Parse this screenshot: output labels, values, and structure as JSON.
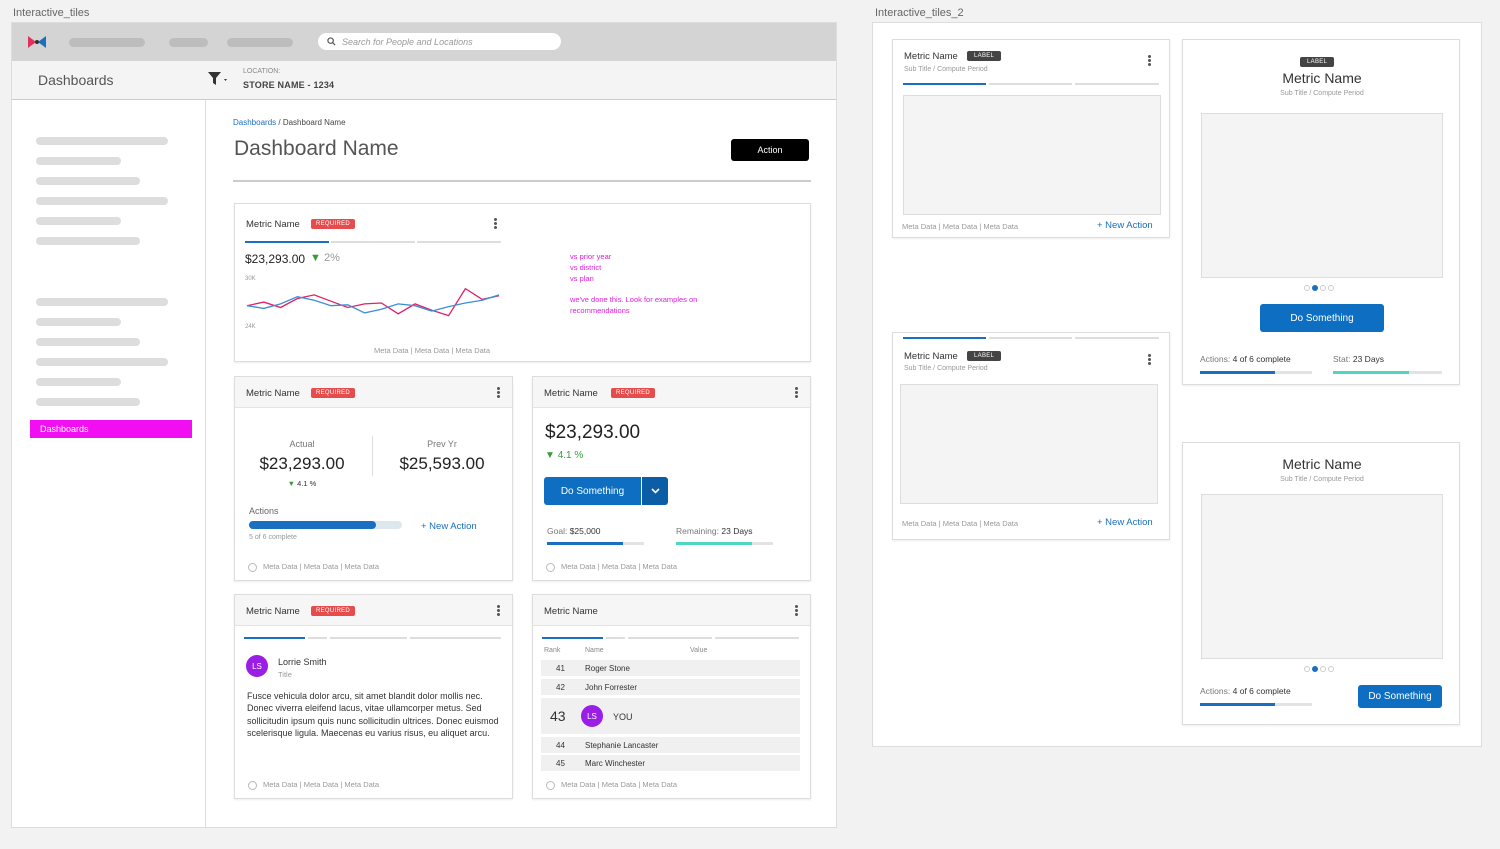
{
  "frame1_label": "Interactive_tiles",
  "frame2_label": "Interactive_tiles_2",
  "search": {
    "placeholder": "Search for People and Locations"
  },
  "header": {
    "title": "Dashboards",
    "location_label": "LOCATION:",
    "location_value": "STORE NAME - 1234"
  },
  "sidebar": {
    "active_label": "Dashboards"
  },
  "breadcrumb": {
    "root": "Dashboards",
    "separator": " / ",
    "current": "Dashboard Name"
  },
  "page": {
    "title": "Dashboard Name",
    "action_label": "Action"
  },
  "colors": {
    "accent": "#1a6fc1",
    "required": "#e74c4c",
    "magenta": "#f20ef2",
    "teal": "#4fd6c3"
  },
  "card_trend": {
    "metric": "Metric Name",
    "badge": "REQUIRED",
    "value": "$23,293.00",
    "change": "2%",
    "tick_hi": "30K",
    "tick_lo": "24K",
    "notes1": [
      "vs prior year",
      "vs  district",
      "vs plan"
    ],
    "notes2": [
      "we've done this. Look for examples on",
      "recommendations"
    ],
    "meta": "Meta Data | Meta Data | Meta Data"
  },
  "chart_data": {
    "type": "line",
    "ylim": [
      24000,
      30000
    ],
    "series": [
      {
        "values": [
          26700,
          27100,
          26500,
          27500,
          27900,
          27200,
          26500,
          26900,
          27000,
          25800,
          26900,
          26200,
          25600,
          28600,
          27400,
          27800
        ]
      },
      {
        "values": [
          26700,
          26400,
          26900,
          27700,
          27300,
          26700,
          26800,
          25900,
          26300,
          26900,
          26700,
          26100,
          26600,
          27000,
          27300,
          27900
        ]
      }
    ]
  },
  "card_compare": {
    "metric": "Metric Name",
    "badge": "REQUIRED",
    "actual_label": "Actual",
    "actual_value": "$23,293.00",
    "actual_change": "4.1 %",
    "prev_label": "Prev Yr",
    "prev_value": "$25,593.00",
    "actions_label": "Actions",
    "actions_progress": 0.83,
    "new_action": "+ New Action",
    "complete": "5 of 6 complete",
    "meta": "Meta Data | Meta Data | Meta Data"
  },
  "card_goal": {
    "metric": "Metric Name",
    "badge": "REQUIRED",
    "value": "$23,293.00",
    "change": "4.1 %",
    "button": "Do Something",
    "goal_label": "Goal:",
    "goal_value": "$25,000",
    "goal_progress": 0.78,
    "remaining_label": "Remaining:",
    "remaining_value": "23 Days",
    "remaining_progress": 0.78,
    "meta": "Meta Data | Meta Data | Meta Data"
  },
  "card_person": {
    "metric": "Metric Name",
    "badge": "REQUIRED",
    "initials": "LS",
    "name": "Lorrie Smith",
    "title": "Title",
    "body": "Fusce vehicula dolor arcu, sit amet blandit dolor mollis nec. Donec viverra eleifend lacus, vitae ullamcorper metus. Sed sollicitudin ipsum quis nunc sollicitudin ultrices. Donec euismod scelerisque ligula. Maecenas eu varius risus, eu aliquet arcu.",
    "meta": "Meta Data | Meta Data | Meta Data"
  },
  "card_rank": {
    "metric": "Metric Name",
    "col_rank": "Rank",
    "col_name": "Name",
    "col_value": "Value",
    "rows": [
      {
        "rank": "41",
        "name": "Roger Stone"
      },
      {
        "rank": "42",
        "name": "John Forrester"
      },
      {
        "rank": "43",
        "initials": "LS",
        "name": "YOU"
      },
      {
        "rank": "44",
        "name": "Stephanie Lancaster"
      },
      {
        "rank": "45",
        "name": "Marc  Winchester"
      }
    ],
    "meta": "Meta Data | Meta Data | Meta Data"
  },
  "tile_a": {
    "metric": "Metric Name",
    "label": "LABEL",
    "subtitle": "Sub Title / Compute Period",
    "meta": "Meta Data | Meta Data | Meta Data",
    "new_action": "+ New Action"
  },
  "tile_b": {
    "metric": "Metric Name",
    "label": "LABEL",
    "subtitle": "Sub Title / Compute Period",
    "meta": "Meta Data | Meta Data | Meta Data",
    "new_action": "+ New Action"
  },
  "tile_c": {
    "label": "LABEL",
    "metric": "Metric Name",
    "subtitle": "Sub Title / Compute Period",
    "button": "Do Something",
    "actions_label": "Actions:",
    "actions_value": "4 of 6 complete",
    "actions_progress": 0.67,
    "stat_label": "Stat:",
    "stat_value": "23 Days",
    "stat_progress": 0.7
  },
  "tile_d": {
    "metric": "Metric Name",
    "subtitle": "Sub Title / Compute Period",
    "actions_label": "Actions:",
    "actions_value": "4 of 6 complete",
    "actions_progress": 0.67,
    "button": "Do Something"
  }
}
